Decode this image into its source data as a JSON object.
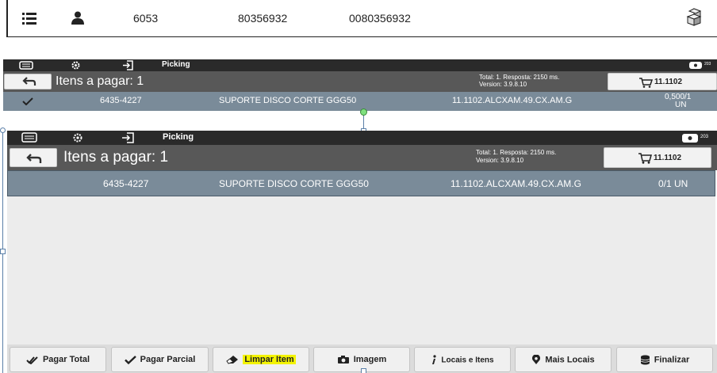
{
  "header": {
    "col1": "6053",
    "col2": "80356932",
    "col3": "0080356932",
    "icons": [
      "list-icon",
      "user-icon",
      "boxes-icon"
    ]
  },
  "app": {
    "menu_label": "Picking",
    "items_title": "Itens a pagar: 1",
    "total_line": "Total: 1. Resposta: 2150 ms.",
    "version_line": "Version: 3.9.8.10",
    "cart_label": "11.1102",
    "badge_count": "203"
  },
  "screenshot1": {
    "row": {
      "code": "6435-4227",
      "description": "SUPORTE DISCO CORTE GGG50",
      "location": "11.1102.ALCXAM.49.CX.AM.G",
      "qty_line1": "0,500/1",
      "qty_line2": "UN"
    }
  },
  "screenshot2": {
    "row": {
      "code": "6435-4227",
      "description": "SUPORTE DISCO CORTE GGG50",
      "location": "11.1102.ALCXAM.49.CX.AM.G",
      "qty": "0/1 UN"
    }
  },
  "bottom_buttons": {
    "pagar_total": "Pagar Total",
    "pagar_parcial": "Pagar Parcial",
    "limpar_item": "Limpar Item",
    "imagem": "Imagem",
    "locais_itens": "Locais e Itens",
    "mais_locais": "Mais Locais",
    "finalizar": "Finalizar"
  },
  "colors": {
    "dark_bar": "#2a2a2a",
    "gray_bar": "#585858",
    "row_bg": "#7a8b99",
    "highlight": "#f3f300"
  }
}
